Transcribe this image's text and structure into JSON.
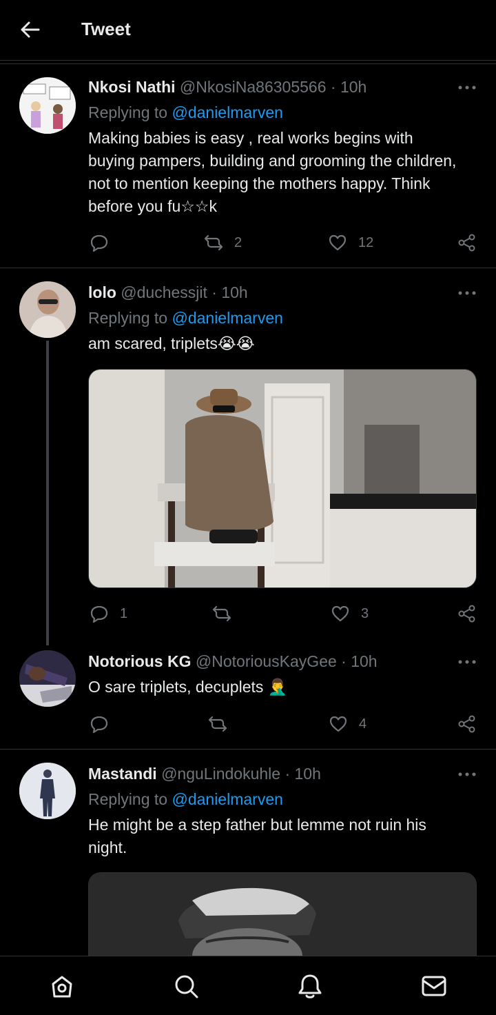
{
  "header": {
    "title": "Tweet",
    "back_icon": "arrow-left-icon"
  },
  "tweets": [
    {
      "name": "Nkosi Nathi",
      "handle": "@NkosiNa86305566",
      "time": "· 10h",
      "replying_label": "Replying to",
      "mention": "@danielmarven",
      "text": "Making babies is easy , real works begins with buying pampers, building and grooming the children,  not to mention keeping the mothers happy. Think before you fu☆☆k",
      "retweets": "2",
      "likes": "12",
      "replies": ""
    },
    {
      "name": "lolo",
      "handle": "@duchessjit",
      "time": "· 10h",
      "replying_label": "Replying to",
      "mention": "@danielmarven",
      "text": "am scared, triplets😭😭",
      "replies": "1",
      "retweets": "",
      "likes": "3"
    },
    {
      "name": "Notorious KG",
      "handle": "@NotoriousKayGee",
      "time": "· 10h",
      "text": "O sare  triplets,  decuplets 🤦‍♂️",
      "replies": "",
      "retweets": "",
      "likes": "4"
    },
    {
      "name": "Mastandi",
      "handle": "@nguLindokuhle",
      "time": "· 10h",
      "replying_label": "Replying to",
      "mention": "@danielmarven",
      "text": "He might be a step father but lemme  not ruin his night."
    }
  ],
  "nav": [
    "home-icon",
    "search-icon",
    "notifications-icon",
    "messages-icon"
  ],
  "colors": {
    "background": "#000000",
    "text": "#e7e9ea",
    "secondary": "#71767b",
    "accent": "#1d9bf0",
    "divider": "#2f3336"
  }
}
